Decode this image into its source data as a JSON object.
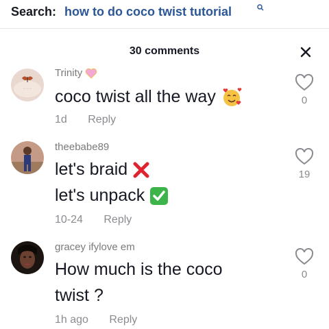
{
  "search": {
    "label": "Search:",
    "query": "how to do coco twist tutorial"
  },
  "comments_header": {
    "count_label": "30 comments"
  },
  "comments": [
    {
      "username": "Trinity",
      "lines": [
        "coco twist all the way"
      ],
      "time": "1d",
      "reply": "Reply",
      "likes": "0"
    },
    {
      "username": "theebabe89",
      "lines": [
        "let's braid",
        "let's unpack"
      ],
      "time": "10-24",
      "reply": "Reply",
      "likes": "19"
    },
    {
      "username": "gracey ifylove em",
      "lines": [
        "How much is the coco",
        "twist ?"
      ],
      "time": "1h ago",
      "reply": "Reply",
      "likes": "0"
    }
  ],
  "colors": {
    "accent_link": "#2b5797",
    "muted": "#8a8b91",
    "heart_outline": "#8a8b91",
    "red_cross": "#e0242f",
    "green_check": "#3cb44a"
  }
}
